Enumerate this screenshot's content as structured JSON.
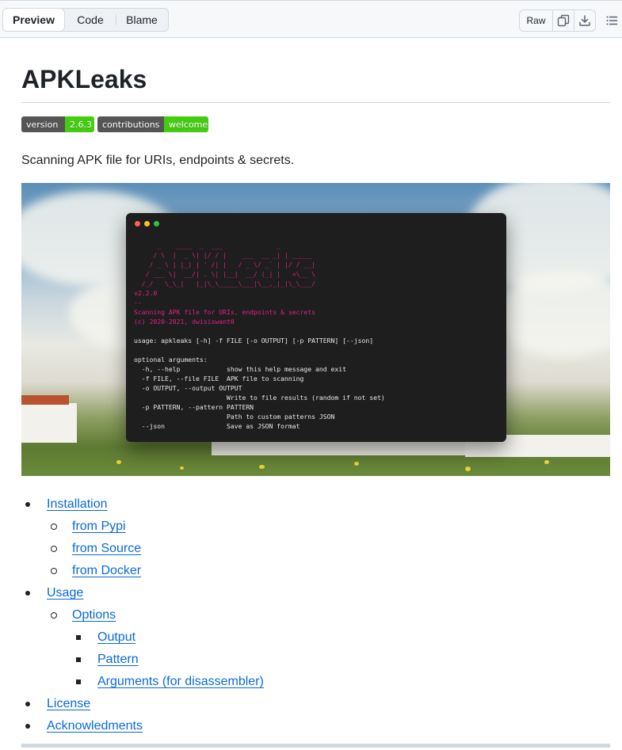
{
  "toolbar": {
    "tabs": [
      {
        "label": "Preview",
        "active": true
      },
      {
        "label": "Code",
        "active": false
      },
      {
        "label": "Blame",
        "active": false
      }
    ],
    "raw_label": "Raw",
    "icons": [
      "copy-icon",
      "download-icon",
      "list-unordered-icon"
    ]
  },
  "readme": {
    "title": "APKLeaks",
    "badges": [
      {
        "left": "version",
        "right": "2.6.3"
      },
      {
        "left": "contributions",
        "right": "welcome"
      }
    ],
    "description": "Scanning APK file for URIs, endpoints & secrets.",
    "terminal": {
      "version": "v2.2.0",
      "sep": "--",
      "tagline": "Scanning APK file for URIs, endpoints & secrets",
      "copyright": "(c) 2020-2021, dwisiswant0",
      "usage": "usage: apkleaks [-h] -f FILE [-o OUTPUT] [-p PATTERN] [--json]",
      "opt_header": "optional arguments:",
      "opt_lines": [
        "  -h, --help            show this help message and exit",
        "  -f FILE, --file FILE  APK file to scanning",
        "  -o OUTPUT, --output OUTPUT",
        "                        Write to file results (random if not set)",
        "  -p PATTERN, --pattern PATTERN",
        "                        Path to custom patterns JSON",
        "  --json                Save as JSON format"
      ]
    },
    "toc": {
      "installation": "Installation",
      "from_pypi": "from Pypi",
      "from_source": "from Source",
      "from_docker": "from Docker",
      "usage": "Usage",
      "options": "Options",
      "output": "Output",
      "pattern": "Pattern",
      "arguments": "Arguments (for disassembler)",
      "license": "License",
      "acknowledgments": "Acknowledments"
    }
  },
  "colors": {
    "link": "#0969da",
    "terminal_text": "#e0218a",
    "badge_green": "#44cc11",
    "badge_grey": "#555555"
  }
}
